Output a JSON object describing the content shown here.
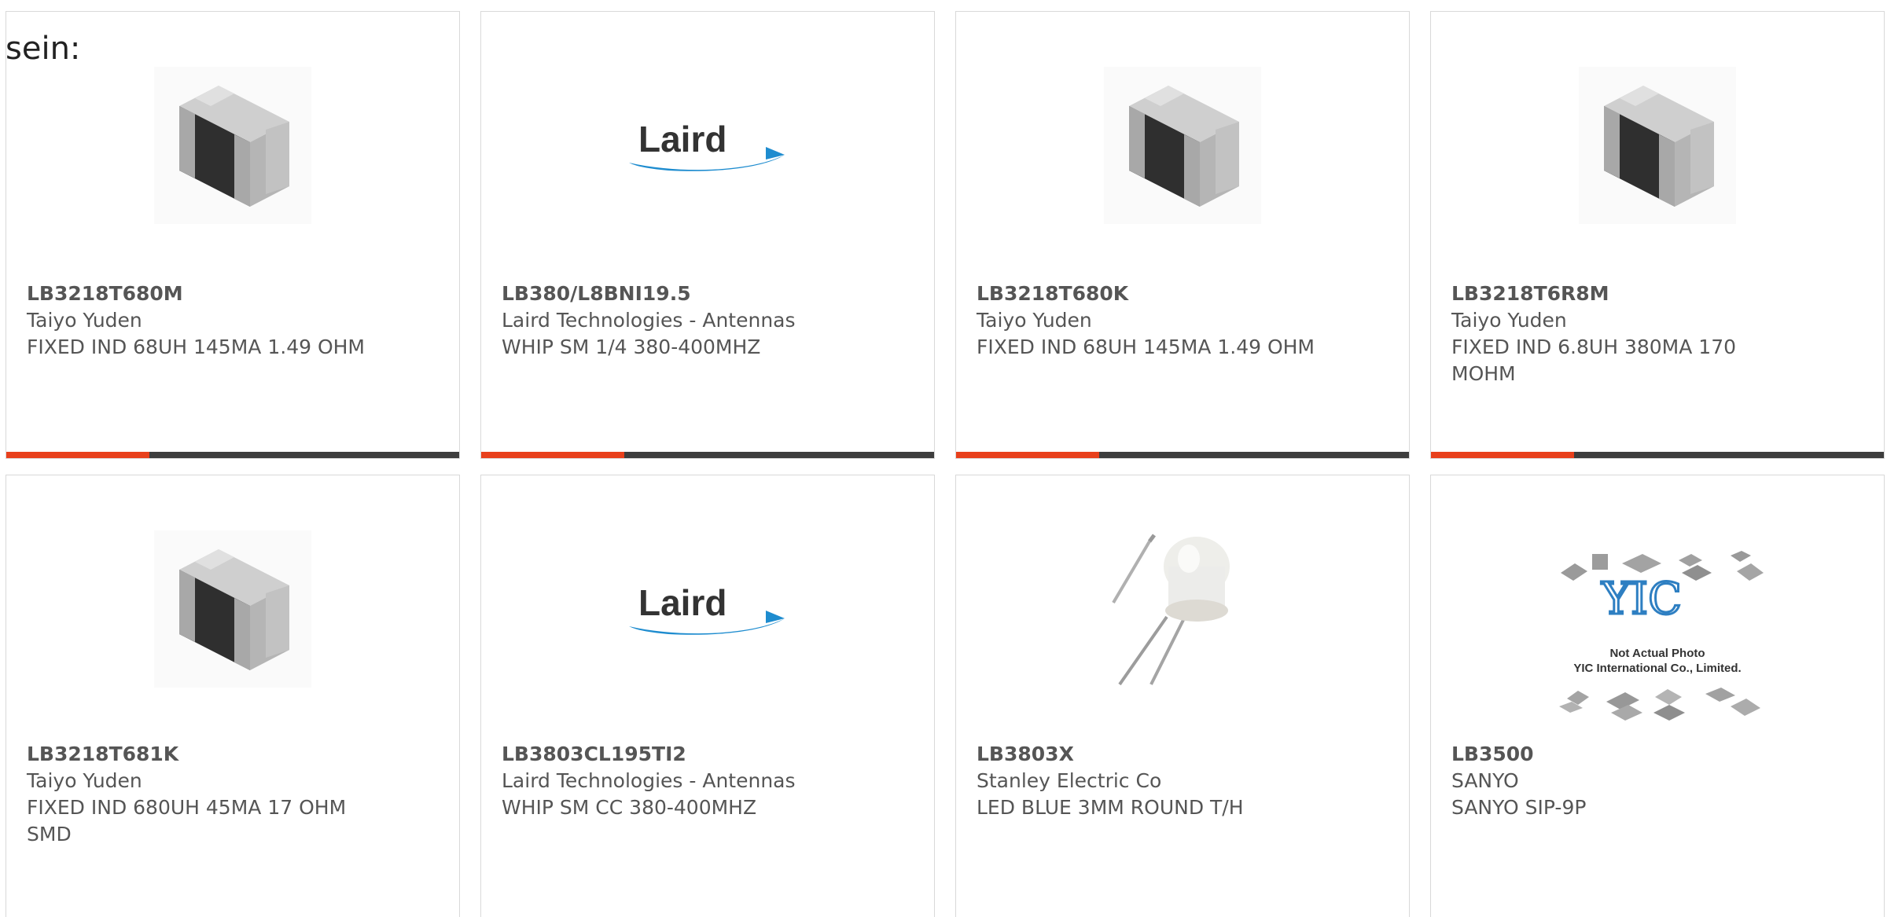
{
  "lead_text": "sein:",
  "colors": {
    "accent": "#e8401c",
    "bar": "#3d3d3d",
    "border": "#d9d9d9",
    "text": "#555555"
  },
  "cards": [
    {
      "part": "LB3218T680M",
      "manufacturer": "Taiyo Yuden",
      "description": "FIXED IND 68UH 145MA 1.49 OHM",
      "image": "chip-inductor-image"
    },
    {
      "part": "LB380/L8BNI19.5",
      "manufacturer": "Laird Technologies - Antennas",
      "description": "WHIP SM 1/4 380-400MHZ",
      "image": "laird-logo",
      "logo_text": "Laird"
    },
    {
      "part": "LB3218T680K",
      "manufacturer": "Taiyo Yuden",
      "description": "FIXED IND 68UH 145MA 1.49 OHM",
      "image": "chip-inductor-image"
    },
    {
      "part": "LB3218T6R8M",
      "manufacturer": "Taiyo Yuden",
      "description": "FIXED IND 6.8UH 380MA 170 MOHM",
      "image": "chip-inductor-image"
    },
    {
      "part": "LB3218T681K",
      "manufacturer": "Taiyo Yuden",
      "description": "FIXED IND 680UH 45MA 17 OHM SMD",
      "image": "chip-inductor-image"
    },
    {
      "part": "LB3803CL195TI2",
      "manufacturer": "Laird Technologies - Antennas",
      "description": "WHIP SM CC 380-400MHZ",
      "image": "laird-logo",
      "logo_text": "Laird"
    },
    {
      "part": "LB3803X",
      "manufacturer": "Stanley Electric Co",
      "description": "LED BLUE 3MM ROUND T/H",
      "image": "led-image"
    },
    {
      "part": "LB3500",
      "manufacturer": "SANYO",
      "description": "SANYO SIP-9P",
      "image": "not-actual-photo-image",
      "photo_note": "Not Actual Photo",
      "photo_company": "YIC International Co., Limited.",
      "photo_logo": "YIC"
    }
  ]
}
